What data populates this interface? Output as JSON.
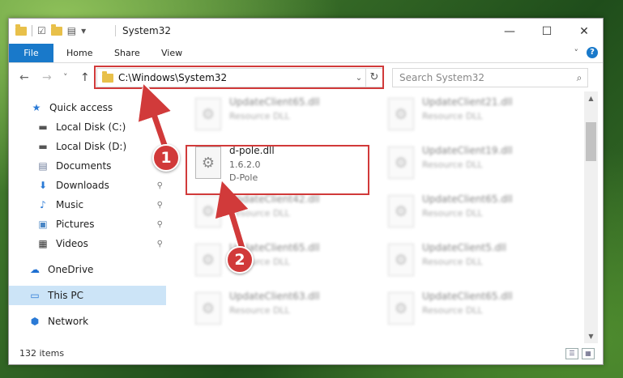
{
  "window": {
    "title": "System32",
    "quick_access_dropdown": "▾",
    "controls": {
      "minimize": "—",
      "maximize": "☐",
      "close": "✕"
    }
  },
  "ribbon": {
    "tabs": [
      "File",
      "Home",
      "Share",
      "View"
    ],
    "collapse": "˅",
    "help": "?"
  },
  "nav": {
    "back": "←",
    "forward": "→",
    "recent": "˅",
    "up": "↑"
  },
  "address": {
    "path": "C:\\Windows\\System32",
    "dropdown": "⌄",
    "refresh": "↻"
  },
  "search": {
    "placeholder": "Search System32",
    "icon": "⌕"
  },
  "sidebar": {
    "items": [
      {
        "label": "Quick access",
        "icon": "★",
        "color": "#2a7ad6",
        "pinned": false
      },
      {
        "label": "Local Disk (C:)",
        "icon": "▬",
        "color": "#555",
        "pinned": false
      },
      {
        "label": "Local Disk (D:)",
        "icon": "▬",
        "color": "#555",
        "pinned": false
      },
      {
        "label": "Documents",
        "icon": "▤",
        "color": "#6b7a99",
        "pinned": true
      },
      {
        "label": "Downloads",
        "icon": "⬇",
        "color": "#2a7ad6",
        "pinned": true
      },
      {
        "label": "Music",
        "icon": "♪",
        "color": "#2a7ad6",
        "pinned": true
      },
      {
        "label": "Pictures",
        "icon": "▣",
        "color": "#4a86c5",
        "pinned": true
      },
      {
        "label": "Videos",
        "icon": "▦",
        "color": "#333",
        "pinned": true
      },
      {
        "label": "OneDrive",
        "icon": "☁",
        "color": "#1e6fd1",
        "pinned": false
      },
      {
        "label": "This PC",
        "icon": "▭",
        "color": "#2a7ad6",
        "pinned": false
      },
      {
        "label": "Network",
        "icon": "⬢",
        "color": "#2a7ad6",
        "pinned": false
      }
    ],
    "pin_icon": "⚲"
  },
  "files": {
    "highlighted": {
      "name": "d-pole.dll",
      "version": "1.6.2.0",
      "company": "D-Pole"
    },
    "blurred": [
      {
        "name": "UpdateClient65.dll",
        "type": "Resource DLL"
      },
      {
        "name": "UpdateClient21.dll",
        "type": "Resource DLL"
      },
      {
        "name": "UpdateClient19.dll",
        "type": "Resource DLL"
      },
      {
        "name": "UpdateClient42.dll",
        "type": "Resource DLL"
      },
      {
        "name": "UpdateClient65.dll",
        "type": "Resource DLL"
      },
      {
        "name": "UpdateClient65.dll",
        "type": "Resource DLL"
      },
      {
        "name": "UpdateClient5.dll",
        "type": "Resource DLL"
      },
      {
        "name": "UpdateClient63.dll",
        "type": "Resource DLL"
      },
      {
        "name": "UpdateClient65.dll",
        "type": "Resource DLL"
      }
    ],
    "file_icon": "⚙"
  },
  "status": {
    "item_count": "132 items"
  },
  "view_buttons": {
    "details": "☰",
    "tiles": "▦"
  },
  "scroll": {
    "up": "▲",
    "down": "▼"
  },
  "steps": [
    "1",
    "2"
  ],
  "colors": {
    "accent": "#1979ca",
    "highlight": "#d13a3a",
    "selected": "#cce4f7"
  }
}
